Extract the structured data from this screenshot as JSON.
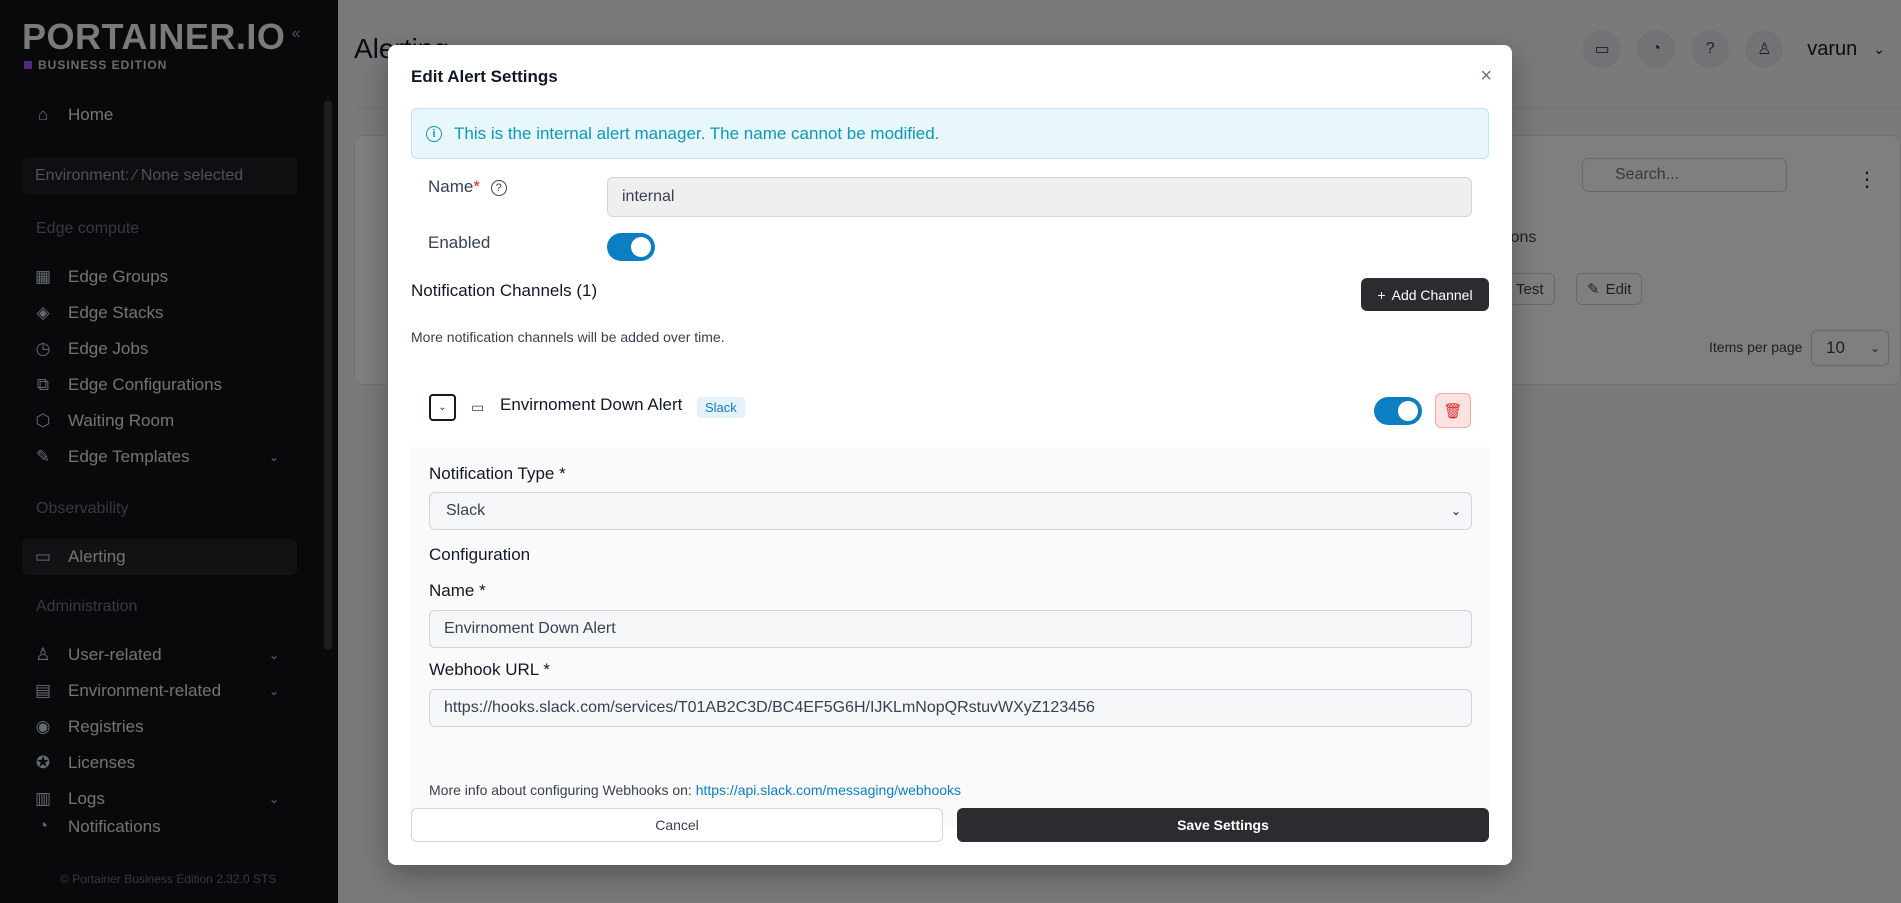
{
  "sidebar": {
    "logo": "PORTAINER.IO",
    "edition": "BUSINESS EDITION",
    "home": "Home",
    "environment": "Environment: ⁄ None selected",
    "edge_section": "Edge compute",
    "edge_items": [
      "Edge Groups",
      "Edge Stacks",
      "Edge Jobs",
      "Edge Configurations",
      "Waiting Room",
      "Edge Templates"
    ],
    "observability_section": "Observability",
    "alerting": "Alerting",
    "admin_section": "Administration",
    "admin_items": [
      "User-related",
      "Environment-related",
      "Registries",
      "Licenses",
      "Logs",
      "Notifications"
    ],
    "version": "© Portainer Business Edition 2.32.0 STS"
  },
  "page": {
    "title": "Alerting",
    "username": "varun",
    "search_placeholder": "Search...",
    "column_partial": "ions",
    "test_label": "Test",
    "edit_label": "Edit",
    "items_per_page_label": "Items per page",
    "items_per_page_value": "10"
  },
  "modal": {
    "title": "Edit Alert Settings",
    "info": "This is the internal alert manager. The name cannot be modified.",
    "name_label": "Name",
    "name_required": "*",
    "name_value": "internal",
    "enabled_label": "Enabled",
    "enabled": true,
    "channels_title": "Notification Channels (1)",
    "add_channel": "Add Channel",
    "more_text": "More notification channels will be added over time.",
    "channel": {
      "name": "Envirnoment Down Alert",
      "badge": "Slack",
      "enabled": true,
      "notification_type_label": "Notification Type *",
      "notification_type_value": "Slack",
      "configuration_label": "Configuration",
      "config_name_label": "Name *",
      "config_name_value": "Envirnoment Down Alert",
      "webhook_label": "Webhook URL *",
      "webhook_value": "https://hooks.slack.com/services/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",
      "help_text": "More info about configuring Webhooks on: ",
      "help_link": "https://api.slack.com/messaging/webhooks"
    },
    "cancel": "Cancel",
    "save": "Save Settings"
  },
  "colors": {
    "primary": "#0b7fc2",
    "dark_button": "#2b2c30",
    "info_text": "#0e97b8",
    "danger": "#dc2626"
  }
}
